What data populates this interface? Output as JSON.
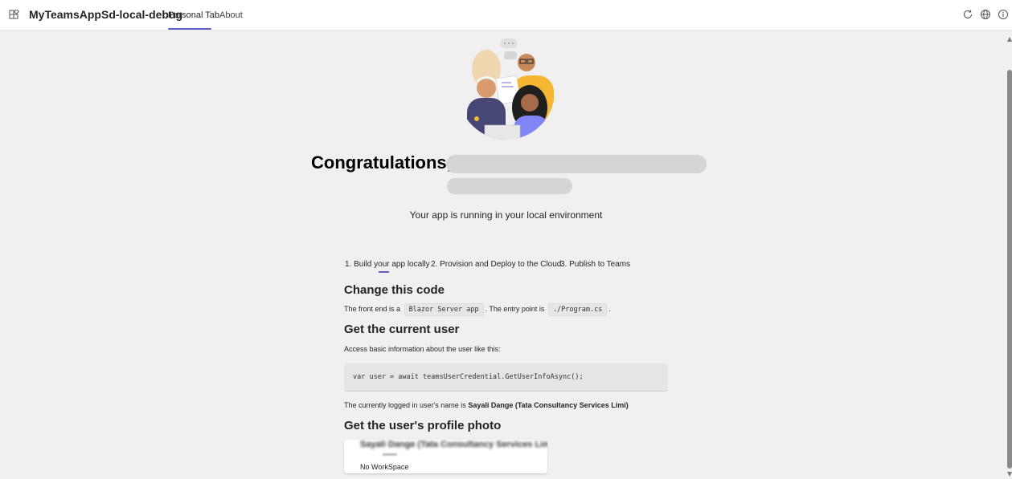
{
  "header": {
    "app_title": "MyTeamsAppSd-local-debug",
    "tabs": [
      {
        "label": "Personal Tab",
        "active": true
      },
      {
        "label": "About",
        "active": false
      }
    ],
    "icons": [
      "apps-icon",
      "refresh-icon",
      "globe-icon",
      "info-icon"
    ],
    "accent_color": "#5b5fc7"
  },
  "hero": {
    "image": "team-people-illustration",
    "congrats_prefix": "Congratulations,",
    "running_text": "Your app is running in your local environment"
  },
  "steps": [
    {
      "label": "1. Build your app locally",
      "active": true
    },
    {
      "label": "2. Provision and Deploy to the Cloud",
      "active": false
    },
    {
      "label": "3. Publish to Teams",
      "active": false
    }
  ],
  "sections": {
    "change_code": {
      "title": "Change this code",
      "text_before": "The front end is a",
      "code1": "Blazor Server app",
      "text_middle": ". The entry point is",
      "code2": "./Program.cs",
      "text_after": "."
    },
    "current_user": {
      "title": "Get the current user",
      "description": "Access basic information about the user like this:",
      "code": "var user = await teamsUserCredential.GetUserInfoAsync();",
      "logged_in_prefix": "The currently logged in user's name is",
      "user_name": "Sayali Dange (Tata Consultancy Services Limi)"
    },
    "profile_photo": {
      "title": "Get the user's profile photo",
      "card_name": "Sayali Dange (Tata Consultancy Services Limi)",
      "workspace": "No WorkSpace"
    }
  }
}
